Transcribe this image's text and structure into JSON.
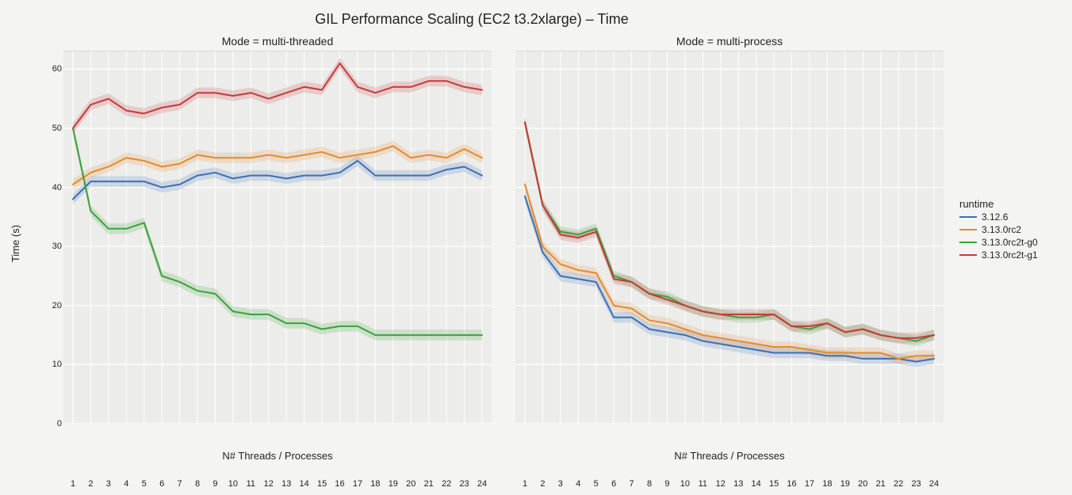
{
  "title": "GIL Performance Scaling (EC2 t3.2xlarge) – Time",
  "ylabel": "Time (s)",
  "xlabel": "N# Threads / Processes",
  "panels": {
    "left": "Mode = multi-threaded",
    "right": "Mode = multi-process"
  },
  "legend": {
    "title": "runtime",
    "items": [
      "3.12.6",
      "3.13.0rc2",
      "3.13.0rc2t-g0",
      "3.13.0rc2t-g1"
    ]
  },
  "colors": {
    "3.12.6": "#3b6fb6",
    "3.13.0rc2": "#e58a2c",
    "3.13.0rc2t-g0": "#3aa23a",
    "3.13.0rc2t-g1": "#c43a3a"
  },
  "chart_data": [
    {
      "type": "line",
      "title": "Mode = multi-threaded",
      "xlabel": "N# Threads / Processes",
      "ylabel": "Time (s)",
      "ylim": [
        0,
        63
      ],
      "x": [
        1,
        2,
        3,
        4,
        5,
        6,
        7,
        8,
        9,
        10,
        11,
        12,
        13,
        14,
        15,
        16,
        17,
        18,
        19,
        20,
        21,
        22,
        23,
        24
      ],
      "series": [
        {
          "name": "3.12.6",
          "values": [
            38,
            41,
            41,
            41,
            41,
            40,
            40.5,
            42,
            42.5,
            41.5,
            42,
            42,
            41.5,
            42,
            42,
            42.5,
            44.5,
            42,
            42,
            42,
            42,
            43,
            43.5,
            42
          ]
        },
        {
          "name": "3.13.0rc2",
          "values": [
            40.5,
            42.5,
            43.5,
            45,
            44.5,
            43.5,
            44,
            45.5,
            45,
            45,
            45,
            45.5,
            45,
            45.5,
            46,
            45,
            45.5,
            46,
            47,
            45,
            45.5,
            45,
            46.5,
            45
          ]
        },
        {
          "name": "3.13.0rc2t-g0",
          "values": [
            50,
            36,
            33,
            33,
            34,
            25,
            24,
            22.5,
            22,
            19,
            18.5,
            18.5,
            17,
            17,
            16,
            16.5,
            16.5,
            15,
            15,
            15,
            15,
            15,
            15,
            15
          ]
        },
        {
          "name": "3.13.0rc2t-g1",
          "values": [
            50,
            54,
            55,
            53,
            52.5,
            53.5,
            54,
            56,
            56,
            55.5,
            56,
            55,
            56,
            57,
            56.5,
            61,
            57,
            56,
            57,
            57,
            58,
            58,
            57,
            56.5
          ]
        }
      ]
    },
    {
      "type": "line",
      "title": "Mode = multi-process",
      "xlabel": "N# Threads / Processes",
      "ylabel": "Time (s)",
      "ylim": [
        0,
        63
      ],
      "x": [
        1,
        2,
        3,
        4,
        5,
        6,
        7,
        8,
        9,
        10,
        11,
        12,
        13,
        14,
        15,
        16,
        17,
        18,
        19,
        20,
        21,
        22,
        23,
        24
      ],
      "series": [
        {
          "name": "3.12.6",
          "values": [
            38.5,
            29,
            25,
            24.5,
            24,
            18,
            18,
            16,
            15.5,
            15,
            14,
            13.5,
            13,
            12.5,
            12,
            12,
            12,
            11.5,
            11.5,
            11,
            11,
            11,
            10.5,
            11
          ]
        },
        {
          "name": "3.13.0rc2",
          "values": [
            40.5,
            30,
            27,
            26,
            25.5,
            20,
            19.5,
            17.5,
            17,
            16,
            15,
            14.5,
            14,
            13.5,
            13,
            13,
            12.5,
            12,
            12,
            12,
            12,
            11,
            11.5,
            11.5
          ]
        },
        {
          "name": "3.13.0rc2t-g0",
          "values": [
            51,
            37,
            32.5,
            32,
            33,
            25,
            24,
            22,
            21.5,
            20,
            19,
            18.5,
            18,
            18,
            18.5,
            16.5,
            16,
            17,
            15.5,
            16,
            15,
            14.5,
            14,
            15
          ]
        },
        {
          "name": "3.13.0rc2t-g1",
          "values": [
            51,
            37,
            32,
            31.5,
            32.5,
            24.5,
            24,
            22,
            21,
            20,
            19,
            18.5,
            18.5,
            18.5,
            18.5,
            16.5,
            16.5,
            17,
            15.5,
            16,
            15,
            14.5,
            14.5,
            15
          ]
        }
      ]
    }
  ]
}
